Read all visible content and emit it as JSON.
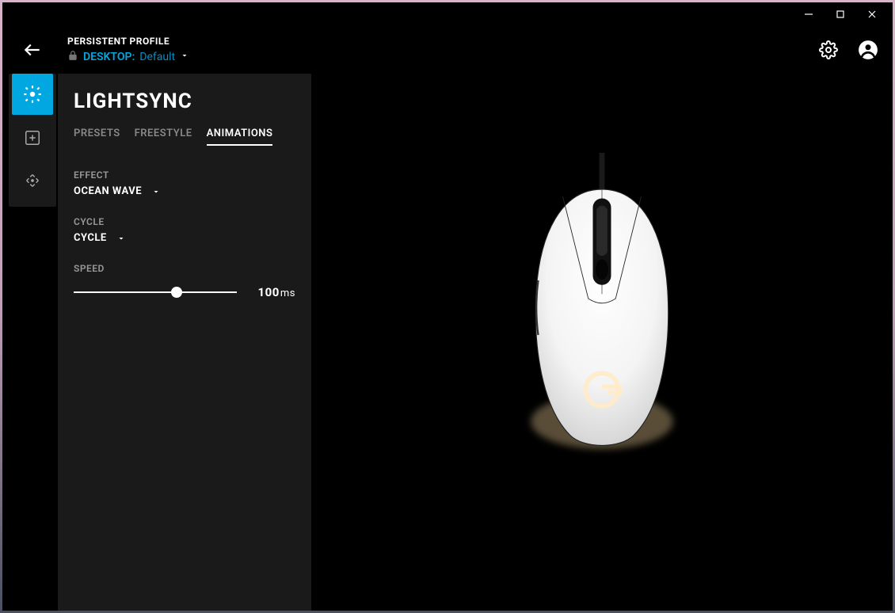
{
  "header": {
    "profile_label": "PERSISTENT PROFILE",
    "desktop_prefix": "DESKTOP:",
    "profile_name": "Default"
  },
  "panel": {
    "title": "LIGHTSYNC",
    "tabs": {
      "presets": "PRESETS",
      "freestyle": "FREESTYLE",
      "animations": "ANIMATIONS"
    },
    "effect": {
      "label": "EFFECT",
      "value": "OCEAN WAVE"
    },
    "cycle": {
      "label": "CYCLE",
      "value": "CYCLE"
    },
    "speed": {
      "label": "SPEED",
      "value": "100",
      "unit": "ms"
    }
  }
}
